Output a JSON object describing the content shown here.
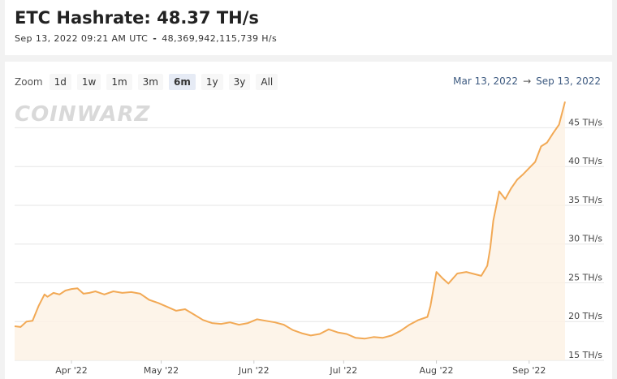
{
  "header": {
    "title": "ETC Hashrate: 48.37 TH/s",
    "timestamp": "Sep 13, 2022 09:21 AM UTC",
    "separator": "-",
    "exact_value": "48,369,942,115,739 H/s"
  },
  "zoom": {
    "label": "Zoom",
    "buttons": [
      "1d",
      "1w",
      "1m",
      "3m",
      "6m",
      "1y",
      "3y",
      "All"
    ],
    "active": "6m"
  },
  "range": {
    "start": "Mar 13, 2022",
    "arrow": "→",
    "end": "Sep 13, 2022"
  },
  "watermark": "COINWARZ",
  "colors": {
    "line": "#f2a955",
    "fill": "#fdf1e3",
    "grid": "#e6e6e6"
  },
  "chart_data": {
    "type": "area",
    "title": "",
    "xlabel": "",
    "ylabel": "",
    "y_unit": "TH/s",
    "x_range": [
      "2022-03-13",
      "2022-09-13"
    ],
    "ylim": [
      15,
      48.5
    ],
    "y_ticks": [
      {
        "value": 15,
        "label": "15 TH/s"
      },
      {
        "value": 20,
        "label": "20 TH/s"
      },
      {
        "value": 25,
        "label": "25 TH/s"
      },
      {
        "value": 30,
        "label": "30 TH/s"
      },
      {
        "value": 35,
        "label": "35 TH/s"
      },
      {
        "value": 40,
        "label": "40 TH/s"
      },
      {
        "value": 45,
        "label": "45 TH/s"
      }
    ],
    "x_ticks": [
      {
        "date": "2022-04-01",
        "label": "Apr '22"
      },
      {
        "date": "2022-05-01",
        "label": "May '22"
      },
      {
        "date": "2022-06-01",
        "label": "Jun '22"
      },
      {
        "date": "2022-07-01",
        "label": "Jul '22"
      },
      {
        "date": "2022-08-01",
        "label": "Aug '22"
      },
      {
        "date": "2022-09-01",
        "label": "Sep '22"
      }
    ],
    "grid": true,
    "legend": "none",
    "series": [
      {
        "x": [
          "2022-03-13",
          "2022-03-15",
          "2022-03-17",
          "2022-03-19",
          "2022-03-21",
          "2022-03-23",
          "2022-03-24",
          "2022-03-26",
          "2022-03-28",
          "2022-03-30",
          "2022-04-01",
          "2022-04-03",
          "2022-04-05",
          "2022-04-07",
          "2022-04-09",
          "2022-04-12",
          "2022-04-15",
          "2022-04-18",
          "2022-04-21",
          "2022-04-24",
          "2022-04-27",
          "2022-04-30",
          "2022-05-03",
          "2022-05-06",
          "2022-05-09",
          "2022-05-12",
          "2022-05-15",
          "2022-05-18",
          "2022-05-21",
          "2022-05-24",
          "2022-05-27",
          "2022-05-30",
          "2022-06-02",
          "2022-06-05",
          "2022-06-08",
          "2022-06-11",
          "2022-06-14",
          "2022-06-17",
          "2022-06-20",
          "2022-06-23",
          "2022-06-26",
          "2022-06-29",
          "2022-07-02",
          "2022-07-05",
          "2022-07-08",
          "2022-07-11",
          "2022-07-14",
          "2022-07-17",
          "2022-07-20",
          "2022-07-23",
          "2022-07-26",
          "2022-07-29",
          "2022-07-30",
          "2022-08-01",
          "2022-08-03",
          "2022-08-05",
          "2022-08-08",
          "2022-08-11",
          "2022-08-14",
          "2022-08-16",
          "2022-08-18",
          "2022-08-19",
          "2022-08-20",
          "2022-08-22",
          "2022-08-24",
          "2022-08-26",
          "2022-08-28",
          "2022-08-30",
          "2022-09-01",
          "2022-09-03",
          "2022-09-05",
          "2022-09-07",
          "2022-09-09",
          "2022-09-11",
          "2022-09-13"
        ],
        "values": [
          19.4,
          19.3,
          20.0,
          20.1,
          22.0,
          23.5,
          23.2,
          23.7,
          23.5,
          24.0,
          24.2,
          24.3,
          23.6,
          23.7,
          23.9,
          23.5,
          23.9,
          23.7,
          23.8,
          23.6,
          22.8,
          22.4,
          21.9,
          21.4,
          21.6,
          20.9,
          20.2,
          19.8,
          19.7,
          19.9,
          19.6,
          19.8,
          20.3,
          20.1,
          19.9,
          19.6,
          18.9,
          18.5,
          18.2,
          18.4,
          19.0,
          18.6,
          18.4,
          17.9,
          17.8,
          18.0,
          17.9,
          18.2,
          18.8,
          19.6,
          20.2,
          20.6,
          22.0,
          26.4,
          25.6,
          24.9,
          26.2,
          26.4,
          26.1,
          25.9,
          27.2,
          29.5,
          33.0,
          36.8,
          35.8,
          37.2,
          38.3,
          39.0,
          39.8,
          40.6,
          42.6,
          43.1,
          44.3,
          45.4,
          48.37
        ]
      }
    ]
  }
}
